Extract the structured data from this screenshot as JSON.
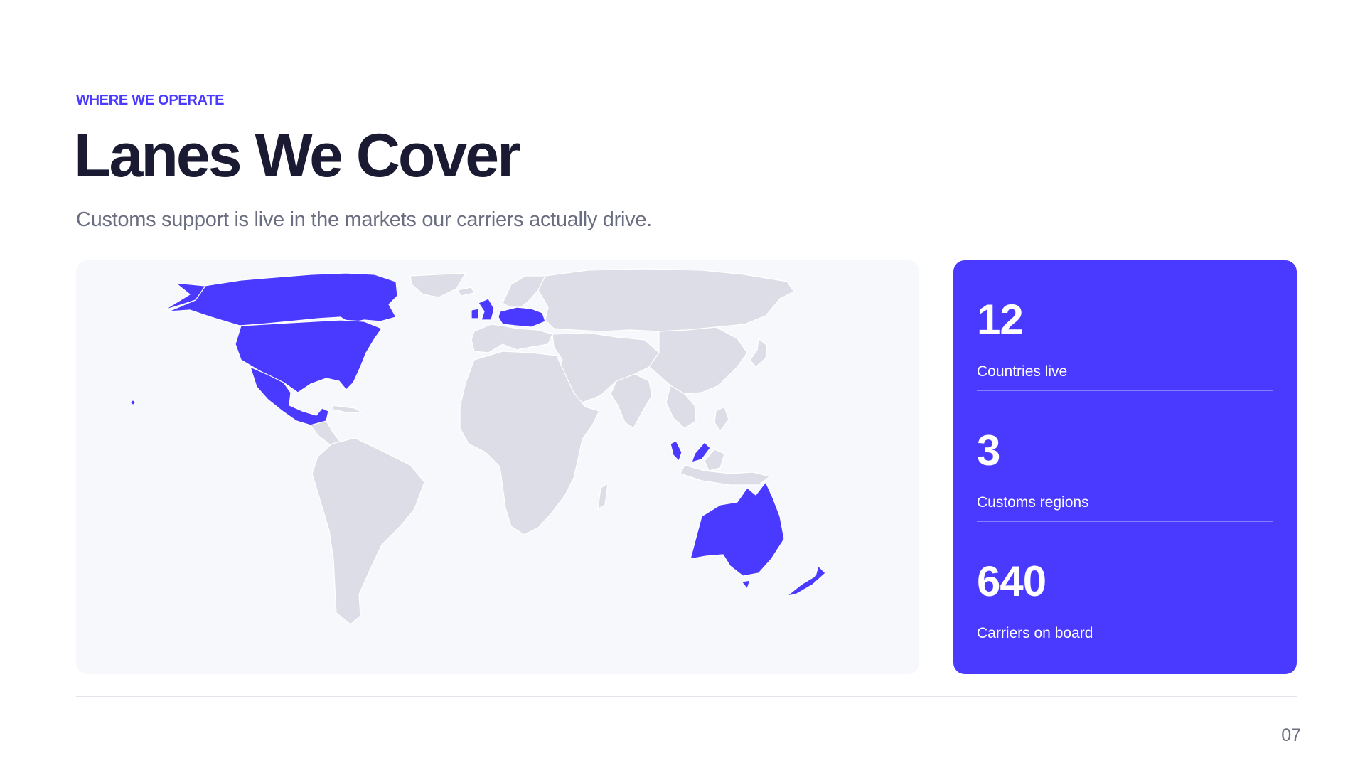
{
  "header": {
    "eyebrow": "WHERE WE OPERATE",
    "title": "Lanes We Cover",
    "subtitle": "Customs support is live in the markets our carriers actually drive."
  },
  "map": {
    "highlight_color": "#4a3aff",
    "base_color": "#dcdde6"
  },
  "stats": [
    {
      "value": "12",
      "label": "Countries live"
    },
    {
      "value": "3",
      "label": "Customs regions"
    },
    {
      "value": "640",
      "label": "Carriers on board"
    }
  ],
  "footer": {
    "page_number": "07"
  },
  "colors": {
    "accent": "#4a3aff",
    "title": "#1b1a33",
    "muted": "#6b6e80"
  }
}
